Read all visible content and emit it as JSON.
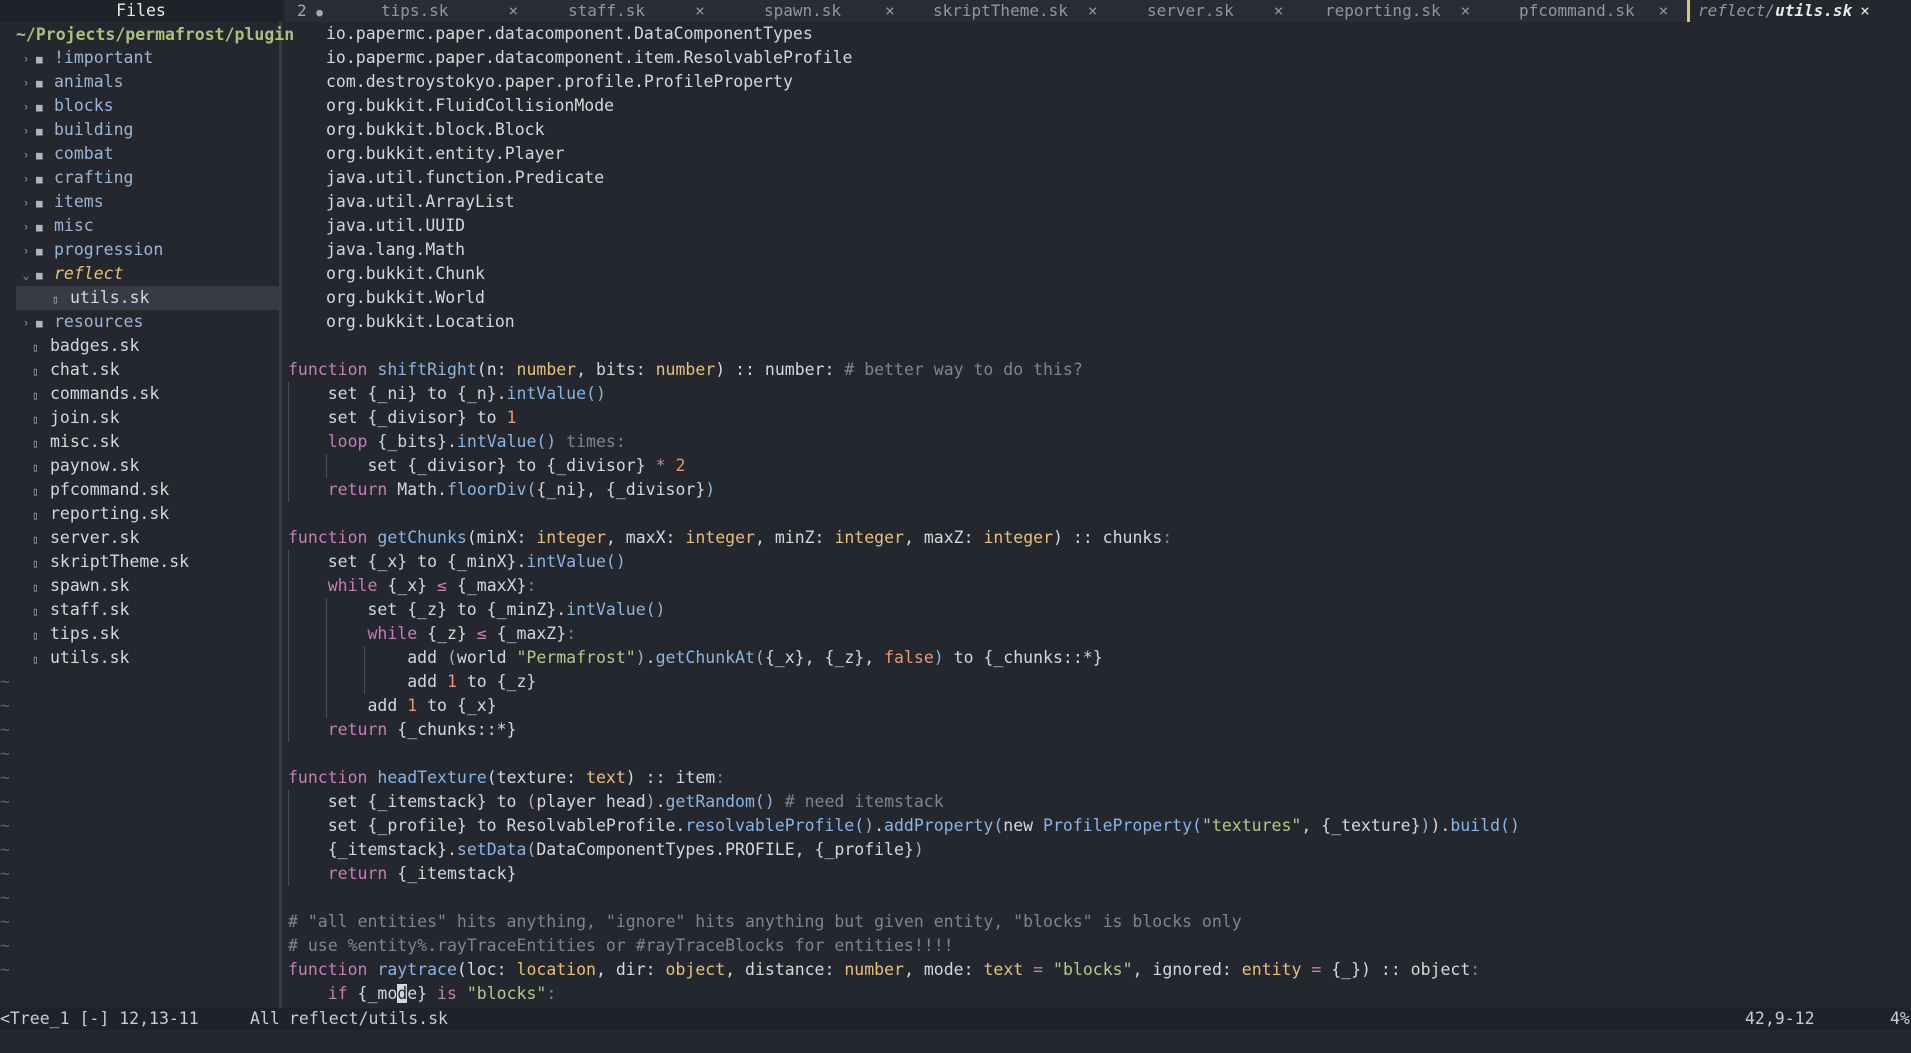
{
  "sidebar": {
    "title": "Files",
    "cwd": "~/Projects/permafrost/plugin",
    "items": [
      {
        "label": "!important",
        "type": "dir"
      },
      {
        "label": "animals",
        "type": "dir"
      },
      {
        "label": "blocks",
        "type": "dir"
      },
      {
        "label": "building",
        "type": "dir"
      },
      {
        "label": "combat",
        "type": "dir"
      },
      {
        "label": "crafting",
        "type": "dir"
      },
      {
        "label": "items",
        "type": "dir"
      },
      {
        "label": "misc",
        "type": "dir"
      },
      {
        "label": "progression",
        "type": "dir"
      },
      {
        "label": "reflect",
        "type": "dir-open"
      },
      {
        "label": "utils.sk",
        "type": "child-file"
      },
      {
        "label": "resources",
        "type": "dir"
      },
      {
        "label": "badges.sk",
        "type": "file"
      },
      {
        "label": "chat.sk",
        "type": "file"
      },
      {
        "label": "commands.sk",
        "type": "file"
      },
      {
        "label": "join.sk",
        "type": "file"
      },
      {
        "label": "misc.sk",
        "type": "file"
      },
      {
        "label": "paynow.sk",
        "type": "file"
      },
      {
        "label": "pfcommand.sk",
        "type": "file"
      },
      {
        "label": "reporting.sk",
        "type": "file"
      },
      {
        "label": "server.sk",
        "type": "file"
      },
      {
        "label": "skriptTheme.sk",
        "type": "file"
      },
      {
        "label": "spawn.sk",
        "type": "file"
      },
      {
        "label": "staff.sk",
        "type": "file"
      },
      {
        "label": "tips.sk",
        "type": "file"
      },
      {
        "label": "utils.sk",
        "type": "file"
      }
    ],
    "filler": "~"
  },
  "tabs": {
    "count": "2",
    "items": [
      "tips.sk",
      "staff.sk",
      "spawn.sk",
      "skriptTheme.sk",
      "server.sk",
      "reporting.sk",
      "pfcommand.sk"
    ],
    "active_dir": "reflect/",
    "active_file": "utils.sk",
    "close": "×"
  },
  "code": {
    "imports": [
      "io.papermc.paper.datacomponent.DataComponentTypes",
      "io.papermc.paper.datacomponent.item.ResolvableProfile",
      "com.destroystokyo.paper.profile.ProfileProperty",
      "org.bukkit.FluidCollisionMode",
      "org.bukkit.block.Block",
      "org.bukkit.entity.Player",
      "java.util.function.Predicate",
      "java.util.ArrayList",
      "java.util.UUID",
      "java.lang.Math",
      "org.bukkit.Chunk",
      "org.bukkit.World",
      "org.bukkit.Location"
    ]
  },
  "status": {
    "tree": "<Tree_1 [-] 12,13-11",
    "tree_pos": "All",
    "file": "reflect/utils.sk",
    "position": "42,9-12",
    "percent": "4%"
  }
}
